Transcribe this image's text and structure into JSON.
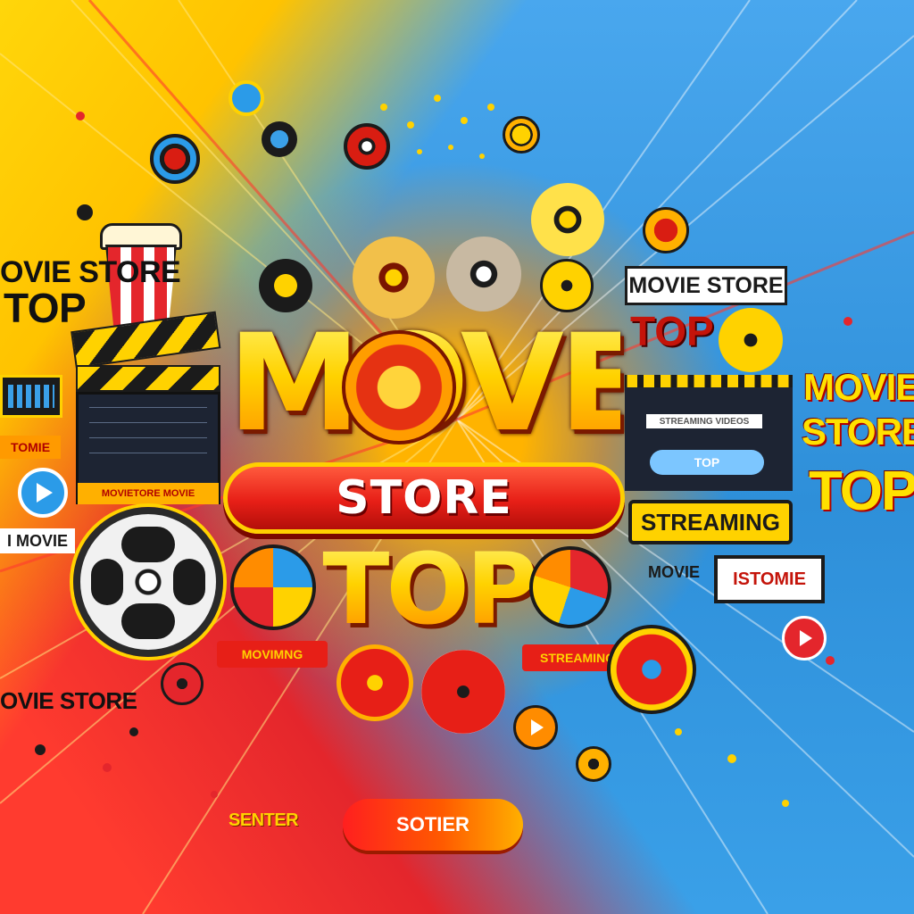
{
  "poster": {
    "headline": "MOVE",
    "headline_band": "STORE",
    "headline_bottom": "TOP"
  },
  "left_panel": {
    "title_line1": "OVIE STORE",
    "title_line2": "TOP",
    "tag_orange": "TOMIE",
    "tag_movie": "I MOVIE",
    "footer_text": "OVIE STORE",
    "clapper_label": "MOVIETORE MOVIE"
  },
  "right_panel": {
    "card_title": "MOVIE STORE",
    "card_subtitle": "TOP",
    "side_line1": "MOVIE",
    "side_line2": "STORE",
    "side_line3": "TOP",
    "card_line": "STREAMING VIDEOS",
    "card_pill": "TOP",
    "streaming_label": "STREAMING",
    "small_tag1": "MOVIE",
    "small_tag2": "ISTOMIE"
  },
  "bottom": {
    "left_ribbon": "MOVIMNG",
    "right_ribbon": "STREAMING",
    "corner_text": "SENTER",
    "button_label": "SOTIER"
  },
  "colors": {
    "sky_blue": "#2f8fd6",
    "brand_yellow": "#ffd200",
    "brand_red": "#e71f17",
    "accent_orange": "#ff8c00"
  },
  "icons": [
    "popcorn-icon",
    "clapperboard-icon",
    "film-reel-icon",
    "play-icon"
  ]
}
